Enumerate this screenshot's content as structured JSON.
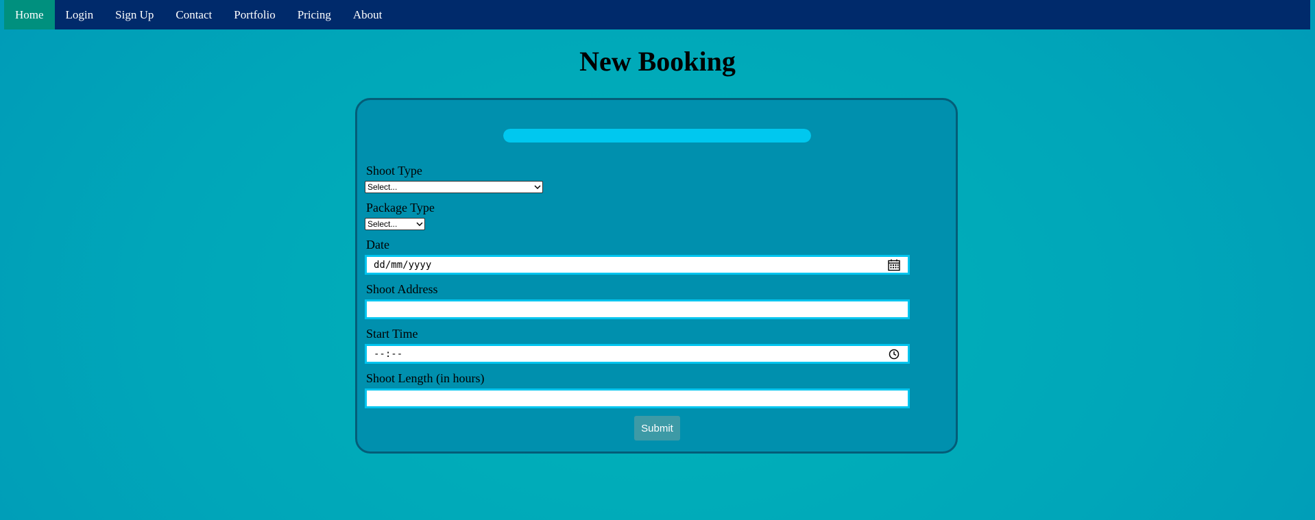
{
  "nav": {
    "items": [
      {
        "label": "Home",
        "active": true
      },
      {
        "label": "Login",
        "active": false
      },
      {
        "label": "Sign Up",
        "active": false
      },
      {
        "label": "Contact",
        "active": false
      },
      {
        "label": "Portfolio",
        "active": false
      },
      {
        "label": "Pricing",
        "active": false
      },
      {
        "label": "About",
        "active": false
      }
    ]
  },
  "page": {
    "title": "New Booking"
  },
  "form": {
    "progress": 1.0,
    "shoot_type": {
      "label": "Shoot Type",
      "value": "Select..."
    },
    "package_type": {
      "label": "Package Type",
      "value": "Select..."
    },
    "date": {
      "label": "Date",
      "value": "dd/mm/yyyy"
    },
    "shoot_address": {
      "label": "Shoot Address",
      "value": ""
    },
    "start_time": {
      "label": "Start Time",
      "value": "--:--"
    },
    "shoot_length": {
      "label": "Shoot Length (in hours)",
      "value": ""
    },
    "submit_label": "Submit"
  },
  "colors": {
    "nav_background": "#002a6b",
    "nav_active": "#00907e",
    "card_background": "#0090ae",
    "card_border": "#045d78",
    "progress_fill": "#00c8ef",
    "input_border": "#00c4ee",
    "submit_background": "#3d9aa6"
  },
  "icons": {
    "date_picker": "calendar-icon",
    "time_picker": "clock-icon",
    "select_arrow": "chevron-down-icon"
  }
}
